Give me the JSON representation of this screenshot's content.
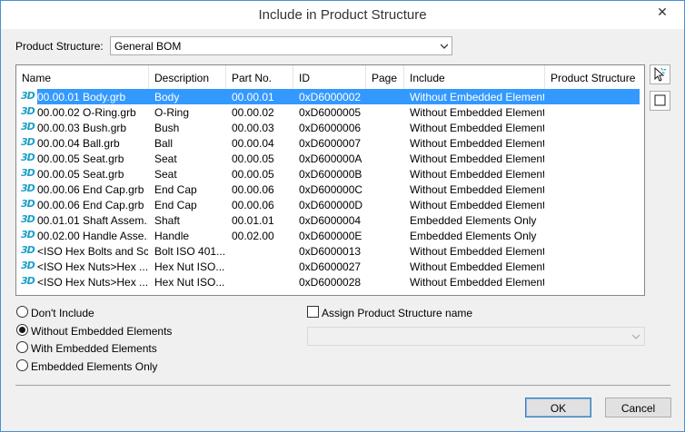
{
  "dialog": {
    "title": "Include in Product Structure",
    "close_glyph": "✕"
  },
  "product_structure": {
    "label": "Product Structure:",
    "value": "General BOM"
  },
  "table": {
    "columns": [
      "Name",
      "Description",
      "Part No.",
      "ID",
      "Page",
      "Include",
      "Product Structure"
    ],
    "icon_text": "3D",
    "rows": [
      {
        "name": "00.00.01 Body.grb",
        "description": "Body",
        "part_no": "00.00.01",
        "id": "0xD6000002",
        "page": "",
        "include": "Without Embedded Elements",
        "product_structure": "",
        "selected": true
      },
      {
        "name": "00.00.02 O-Ring.grb",
        "description": "O-Ring",
        "part_no": "00.00.02",
        "id": "0xD6000005",
        "page": "",
        "include": "Without Embedded Elements",
        "product_structure": ""
      },
      {
        "name": "00.00.03 Bush.grb",
        "description": "Bush",
        "part_no": "00.00.03",
        "id": "0xD6000006",
        "page": "",
        "include": "Without Embedded Elements",
        "product_structure": ""
      },
      {
        "name": "00.00.04 Ball.grb",
        "description": "Ball",
        "part_no": "00.00.04",
        "id": "0xD6000007",
        "page": "",
        "include": "Without Embedded Elements",
        "product_structure": ""
      },
      {
        "name": "00.00.05 Seat.grb",
        "description": "Seat",
        "part_no": "00.00.05",
        "id": "0xD600000A",
        "page": "",
        "include": "Without Embedded Elements",
        "product_structure": ""
      },
      {
        "name": "00.00.05 Seat.grb",
        "description": "Seat",
        "part_no": "00.00.05",
        "id": "0xD600000B",
        "page": "",
        "include": "Without Embedded Elements",
        "product_structure": ""
      },
      {
        "name": "00.00.06 End Cap.grb",
        "description": "End Cap",
        "part_no": "00.00.06",
        "id": "0xD600000C",
        "page": "",
        "include": "Without Embedded Elements",
        "product_structure": ""
      },
      {
        "name": "00.00.06 End Cap.grb",
        "description": "End Cap",
        "part_no": "00.00.06",
        "id": "0xD600000D",
        "page": "",
        "include": "Without Embedded Elements",
        "product_structure": ""
      },
      {
        "name": "00.01.01 Shaft Assem...",
        "description": "Shaft",
        "part_no": "00.01.01",
        "id": "0xD6000004",
        "page": "",
        "include": "Embedded Elements Only",
        "product_structure": ""
      },
      {
        "name": "00.02.00 Handle Asse...",
        "description": "Handle",
        "part_no": "00.02.00",
        "id": "0xD600000E",
        "page": "",
        "include": "Embedded Elements Only",
        "product_structure": ""
      },
      {
        "name": "<ISO Hex Bolts and Sc...",
        "description": "Bolt ISO 401...",
        "part_no": "",
        "id": "0xD6000013",
        "page": "",
        "include": "Without Embedded Elements",
        "product_structure": ""
      },
      {
        "name": "<ISO Hex Nuts>Hex ...",
        "description": "Hex Nut ISO...",
        "part_no": "",
        "id": "0xD6000027",
        "page": "",
        "include": "Without Embedded Elements",
        "product_structure": ""
      },
      {
        "name": "<ISO Hex Nuts>Hex ...",
        "description": "Hex Nut ISO...",
        "part_no": "",
        "id": "0xD6000028",
        "page": "",
        "include": "Without Embedded Elements",
        "product_structure": ""
      }
    ]
  },
  "include_options": [
    {
      "label": "Don't Include",
      "checked": false
    },
    {
      "label": "Without Embedded Elements",
      "checked": true
    },
    {
      "label": "With Embedded Elements",
      "checked": false
    },
    {
      "label": "Embedded Elements Only",
      "checked": false
    }
  ],
  "assign_name": {
    "label": "Assign Product Structure name",
    "checked": false,
    "value": ""
  },
  "buttons": {
    "ok": "OK",
    "cancel": "Cancel"
  }
}
